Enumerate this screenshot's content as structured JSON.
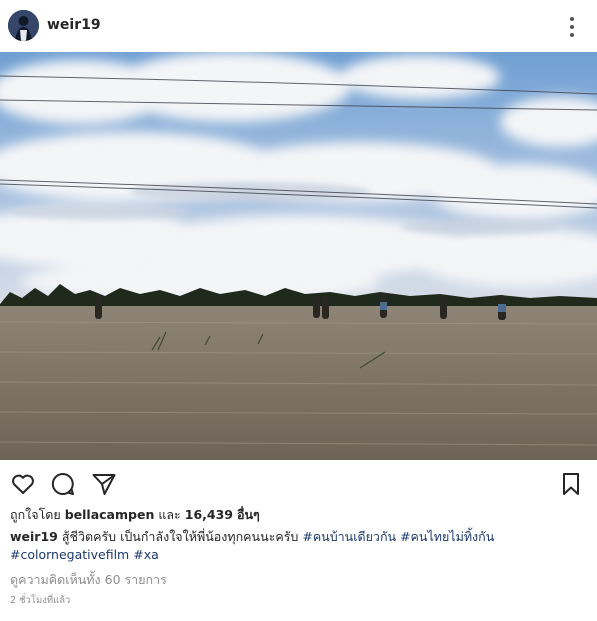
{
  "post": {
    "username": "weir19",
    "liked_by_prefix": "ถูกใจโดย",
    "liked_by_user": "bellacampen",
    "liked_by_and": "และ",
    "like_count": "16,439",
    "liked_by_suffix": "อื่นๆ",
    "caption_user": "weir19",
    "caption_text": "สู้ชีวิตครับ เป็นกำลังใจให้พี่น้องทุกคนนะครับ",
    "hashtags": [
      "#คนบ้านเดียวกัน",
      "#คนไทยไม่ทิ้งกัน",
      "#colornegativefilm",
      "#xa"
    ],
    "view_comments": "ดูความคิดเห็นทั้ง 60 รายการ",
    "timestamp": "2 ชั่วโมงที่แล้ว"
  },
  "icons": {
    "avatar": "avatar",
    "more": "more-options-icon",
    "like": "heart-icon",
    "comment": "comment-icon",
    "share": "share-icon",
    "save": "bookmark-icon"
  },
  "colors": {
    "text": "#262626",
    "secondary": "#8e8e8e",
    "hashtag": "#1e3a6d"
  }
}
